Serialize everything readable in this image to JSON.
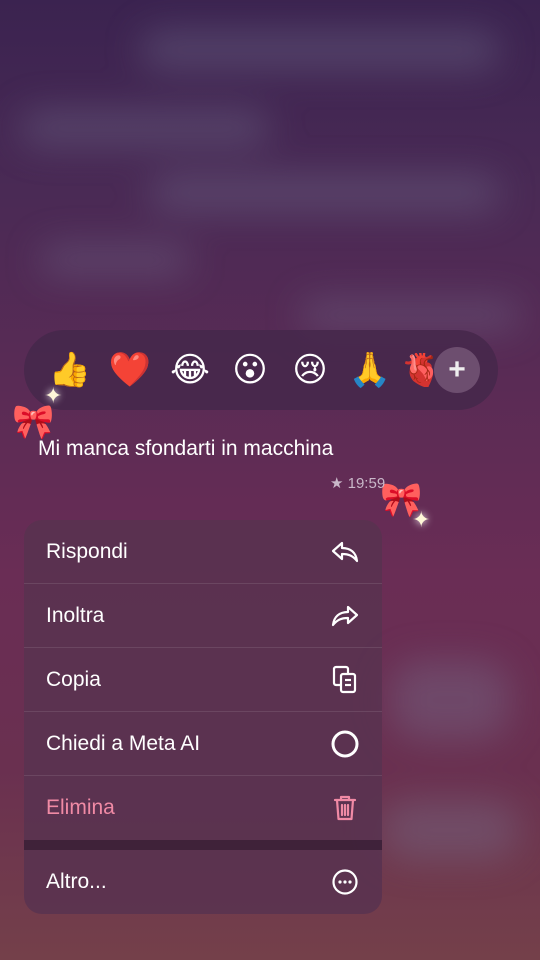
{
  "reactions": {
    "emojis": [
      "👍",
      "❤️",
      "😂",
      "😮",
      "😢",
      "🙏",
      "🫀"
    ],
    "more_label": "+"
  },
  "message": {
    "text": "Mi manca sfondarti in macchina",
    "star": "★",
    "time": "19:59"
  },
  "decorations": {
    "bow": "🎀",
    "sparkle": "✦"
  },
  "menu": {
    "items": [
      {
        "label": "Rispondi",
        "icon": "reply-icon"
      },
      {
        "label": "Inoltra",
        "icon": "forward-icon"
      },
      {
        "label": "Copia",
        "icon": "copy-icon"
      },
      {
        "label": "Chiedi a Meta AI",
        "icon": "meta-ai-icon"
      },
      {
        "label": "Elimina",
        "icon": "trash-icon",
        "color": "#f08aa5"
      },
      {
        "label": "Altro...",
        "icon": "more-icon"
      }
    ]
  },
  "colors": {
    "danger": "#f08aa5",
    "menu_bg": "#583250",
    "reaction_bg": "#46284b"
  }
}
